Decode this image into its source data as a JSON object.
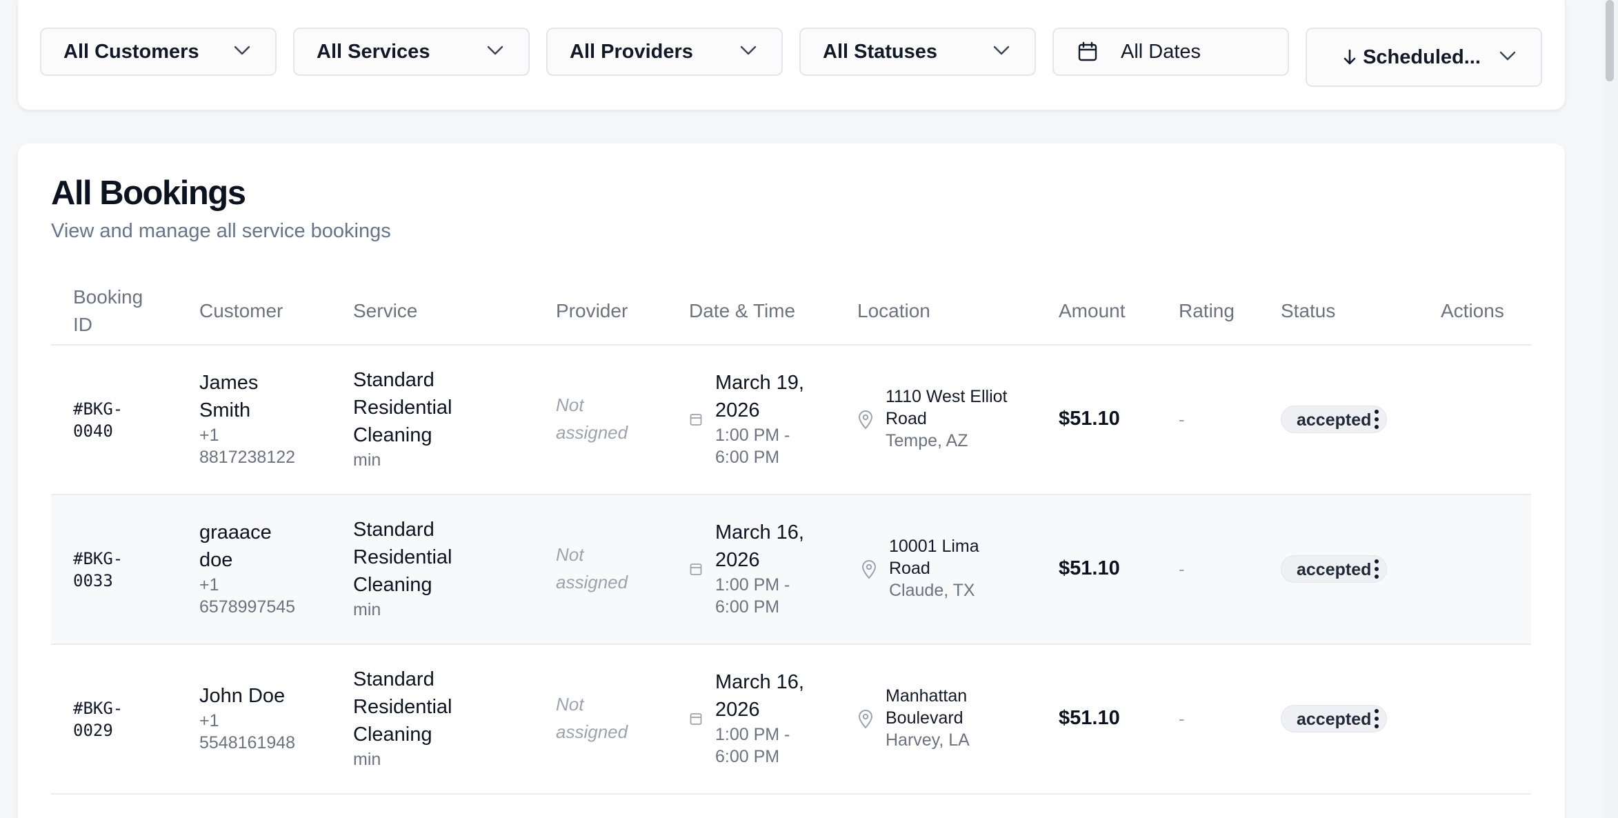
{
  "filters": {
    "customers": "All Customers",
    "services": "All Services",
    "providers": "All Providers",
    "statuses": "All Statuses",
    "dates": "All Dates",
    "sort": "Scheduled..."
  },
  "page": {
    "title": "All Bookings",
    "subtitle": "View and manage all service bookings"
  },
  "table": {
    "headers": {
      "booking_id_1": "Booking",
      "booking_id_2": "ID",
      "customer": "Customer",
      "service": "Service",
      "provider": "Provider",
      "date_time": "Date & Time",
      "location": "Location",
      "amount": "Amount",
      "rating": "Rating",
      "status": "Status",
      "actions": "Actions"
    },
    "rows": [
      {
        "id_1": "#BKG-",
        "id_2": "0040",
        "customer_first": "James",
        "customer_last": "Smith",
        "phone_1": "+1",
        "phone_2": "8817238122",
        "service_1": "Standard",
        "service_2": "Residential",
        "service_3": "Cleaning",
        "duration": "min",
        "provider_1": "Not",
        "provider_2": "assigned",
        "date_1": "March 19,",
        "date_2": "2026",
        "time_1": "1:00 PM -",
        "time_2": "6:00 PM",
        "loc_1": "1110 West Elliot",
        "loc_2": "Road",
        "loc_city": "Tempe, AZ",
        "amount": "$51.10",
        "rating": "-",
        "status": "accepted"
      },
      {
        "id_1": "#BKG-",
        "id_2": "0033",
        "customer_first": "graaace",
        "customer_last": "doe",
        "phone_1": "+1",
        "phone_2": "6578997545",
        "service_1": "Standard",
        "service_2": "Residential",
        "service_3": "Cleaning",
        "duration": "min",
        "provider_1": "Not",
        "provider_2": "assigned",
        "date_1": "March 16,",
        "date_2": "2026",
        "time_1": "1:00 PM -",
        "time_2": "6:00 PM",
        "loc_1": "10001 Lima",
        "loc_2": "Road",
        "loc_city": "Claude, TX",
        "amount": "$51.10",
        "rating": "-",
        "status": "accepted"
      },
      {
        "id_1": "#BKG-",
        "id_2": "0029",
        "customer_first": "John Doe",
        "customer_last": "",
        "phone_1": "+1",
        "phone_2": "5548161948",
        "service_1": "Standard",
        "service_2": "Residential",
        "service_3": "Cleaning",
        "duration": "min",
        "provider_1": "Not",
        "provider_2": "assigned",
        "date_1": "March 16,",
        "date_2": "2026",
        "time_1": "1:00 PM -",
        "time_2": "6:00 PM",
        "loc_1": "Manhattan",
        "loc_2": "Boulevard",
        "loc_city": "Harvey, LA",
        "amount": "$51.10",
        "rating": "-",
        "status": "accepted"
      }
    ]
  },
  "colors": {
    "background": "#f5f6f8",
    "card": "#ffffff",
    "muted_text": "#6b7280",
    "badge_bg": "#eef0f3"
  }
}
